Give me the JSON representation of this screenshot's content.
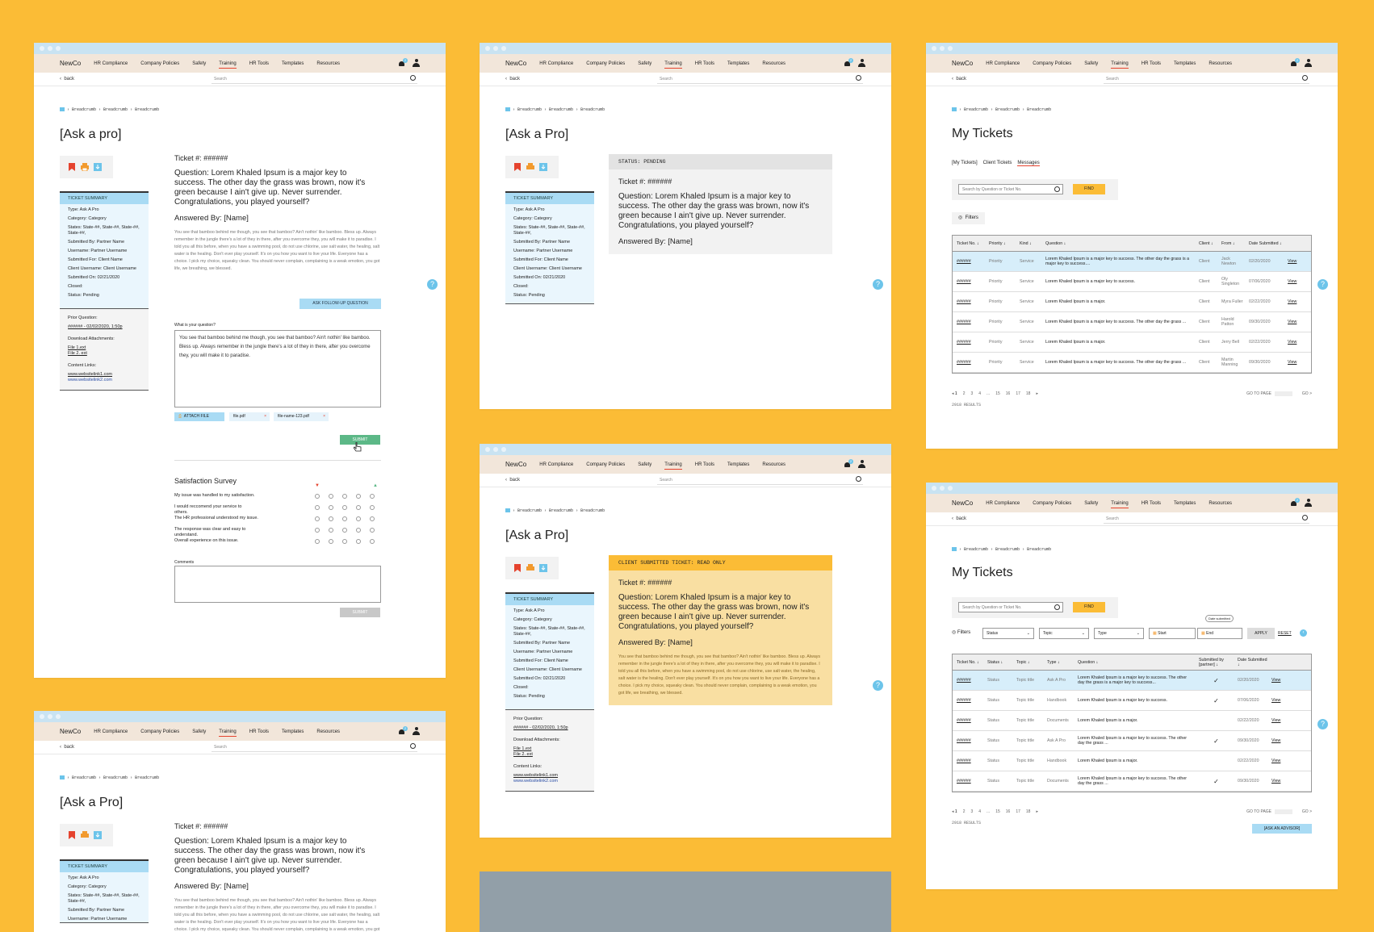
{
  "nav": {
    "logo": "NewCo",
    "items": [
      "HR Compliance",
      "Company Policies",
      "Safety",
      "Training",
      "HR Tools",
      "Templates",
      "Resources"
    ],
    "active": "Training",
    "bell_count": "2",
    "back": "back",
    "search_placeholder": "Search"
  },
  "breadcrumb": [
    "Breadcrumb",
    "Breadcrumb",
    "Breadcrumb"
  ],
  "ask": {
    "title_a": "[Ask a pro]",
    "title_b": "[Ask a Pro]",
    "ticket": "Ticket #: ######",
    "question": "Question: Lorem Khaled Ipsum is a major key to success. The other day the grass was brown, now it's green because I ain't give up. Never surrender. Congratulations, you played yourself?",
    "answered_by": "Answered By: [Name]",
    "answer_para": "You see that bamboo behind me though, you see that bamboo? Ain't nothin' like bamboo. Bless up. Always remember in the jungle there's a lot of they in there, after you overcome they, you will make it to paradise. I told you all this before, when you have a swimming pool, do not use chlorine, use salt water, the healing, salt water is the healing. Don't ever play yourself. It's on you how you want to live your life. Everyone has a choice. I pick my choice, squeaky clean. You should never complain, complaining is a weak emotion, you got life, we breathing, we blessed.",
    "follow_up_btn": "ASK FOLLOW-UP QUESTION",
    "your_question_label": "What is your question?",
    "your_question_value": "You see that bamboo behind me though, you see that bamboo? Ain't nothin' like bamboo. Bless up. Always remember in the jungle there's a lot of they in there, after you overcome they, you will make it to paradise.",
    "attach_label": "ATTACH FILE",
    "files": [
      "file.pdf",
      "file-name-123.pdf"
    ],
    "submit": "SUBMIT",
    "survey_title": "Satisfaction Survey",
    "survey_items": [
      "My issue was handled to my satisfaction.",
      "I would reccomend your service to others.",
      "The HR professional understood my issue.",
      "The response was clear and easy to understand.",
      "Overall experience on this issue."
    ],
    "comments_label": "Comments",
    "status_pending": "STATUS:  PENDING",
    "status_readonly": "CLIENT SUBMITTED TICKET: READ ONLY"
  },
  "summary": {
    "header": "TICKET SUMMARY",
    "rows": [
      "Type:   Ask A Pro",
      "Category:  Category",
      "States:  State-##, State-##, State-##, State-##,",
      "Submitted By:   Partner Name",
      "Username:   Partner Username",
      "Submitted For:   Client Name",
      "Client Username:   Client Username",
      "Submitted On:   02/21/2020",
      "Closed:",
      "Status:   Pending"
    ],
    "prior_label": "Prior Question:",
    "prior_link": "###### - 02/02/2020, 1:50p",
    "downloads_label": "Download Attachments:",
    "downloads": [
      "File 1.ext",
      "File 2. ext"
    ],
    "content_label": "Content Links:",
    "content_links": [
      "www.websitelink1.com",
      "www.websitelink2.com"
    ]
  },
  "tickets": {
    "title": "My Tickets",
    "tabs": [
      "[My Tickets]",
      "Client Tickets",
      "Messages"
    ],
    "search_placeholder": "Search by Question or Ticket No.",
    "find": "FIND",
    "filters": "Filters",
    "headers": [
      "Ticket No. ↓",
      "Priority ↓",
      "Kind ↓",
      "Question ↓",
      "Client ↓",
      "From ↓",
      "Date Submitted ↓"
    ],
    "rows": [
      [
        "######",
        "Priority",
        "Service",
        "Lorem Khaled Ipsum is a major key to success. The other day the grass is a major key to success....",
        "Client",
        "Jack Newton",
        "02/20/2020",
        "View"
      ],
      [
        "######",
        "Priority",
        "Service",
        "Lorem Khaled Ipsum is a major key to success.",
        "Client",
        "Oly Singleton",
        "07/06/2020",
        "View"
      ],
      [
        "######",
        "Priority",
        "Service",
        "Lorem Khaled Ipsum is a major.",
        "Client",
        "Myra Fuller",
        "02/22/2020",
        "View"
      ],
      [
        "######",
        "Priority",
        "Service",
        "Lorem Khaled Ipsum is a major key to success. The other day the grass ...",
        "Client",
        "Harold Patton",
        "09/30/2020",
        "View"
      ],
      [
        "######",
        "Priority",
        "Service",
        "Lorem Khaled Ipsum is a major.",
        "Client",
        "Jerry Bell",
        "02/22/2020",
        "View"
      ],
      [
        "######",
        "Priority",
        "Service",
        "Lorem Khaled Ipsum is a major key to success. The other day the grass ...",
        "Client",
        "Martin Manning",
        "09/30/2020",
        "View"
      ]
    ],
    "pages": [
      "1",
      "2",
      "3",
      "4",
      "...",
      "15",
      "16",
      "17",
      "18"
    ],
    "goto": "GO TO PAGE",
    "go": "GO >",
    "results": "2918 RESULTS",
    "filter_status": "Status",
    "filter_topic": "Topic",
    "filter_type": "Type",
    "filter_start": "Start",
    "filter_end": "End",
    "date_tooltip": "Date submitted",
    "apply": "APPLY",
    "reset": "RESET",
    "headers2": [
      "Ticket No. ↓",
      "Status ↓",
      "Topic ↓",
      "Type ↓",
      "Question ↓",
      "Submitted by [partner] ↓",
      "Date Submitted ↓"
    ],
    "rows2": [
      [
        "######",
        "Status",
        "Topic title",
        "Ask A Pro",
        "Lorem Khaled Ipsum is a major key to success. The other day the grass is a major key to success...",
        "✓",
        "02/20/2020",
        "View"
      ],
      [
        "######",
        "Status",
        "Topic title",
        "Handbook",
        "Lorem Khaled Ipsum is a major key to success.",
        "✓",
        "07/06/2020",
        "View"
      ],
      [
        "######",
        "Status",
        "Topic title",
        "Documents",
        "Lorem Khaled Ipsum is a major.",
        "",
        "02/22/2020",
        "View"
      ],
      [
        "######",
        "Status",
        "Topic title",
        "Ask A Pro",
        "Lorem Khaled Ipsum is a major key to success. The other day the grass ...",
        "✓",
        "09/30/2020",
        "View"
      ],
      [
        "######",
        "Status",
        "Topic title",
        "Handbook",
        "Lorem Khaled Ipsum is a major.",
        "",
        "02/22/2020",
        "View"
      ],
      [
        "######",
        "Status",
        "Topic title",
        "Documents",
        "Lorem Khaled Ipsum is a major key to success. The other day the grass ...",
        "✓",
        "09/30/2020",
        "View"
      ]
    ],
    "ask_advisor": "[ASK AN ADVISOR]"
  },
  "colors": {
    "background": "#fbbc36",
    "accent_blue": "#6cc4ea",
    "nav_bg": "#f2e6da",
    "submit_green": "#5cb887",
    "readonly_bg": "#f9dfa2",
    "active_underline": "#e5432e"
  },
  "icons": [
    "bookmark-icon",
    "print-icon",
    "download-icon",
    "bell-icon",
    "user-icon",
    "search-icon",
    "help-icon",
    "filter-icon",
    "calendar-icon",
    "cursor-icon",
    "thumbs-up-icon",
    "thumbs-down-icon"
  ]
}
